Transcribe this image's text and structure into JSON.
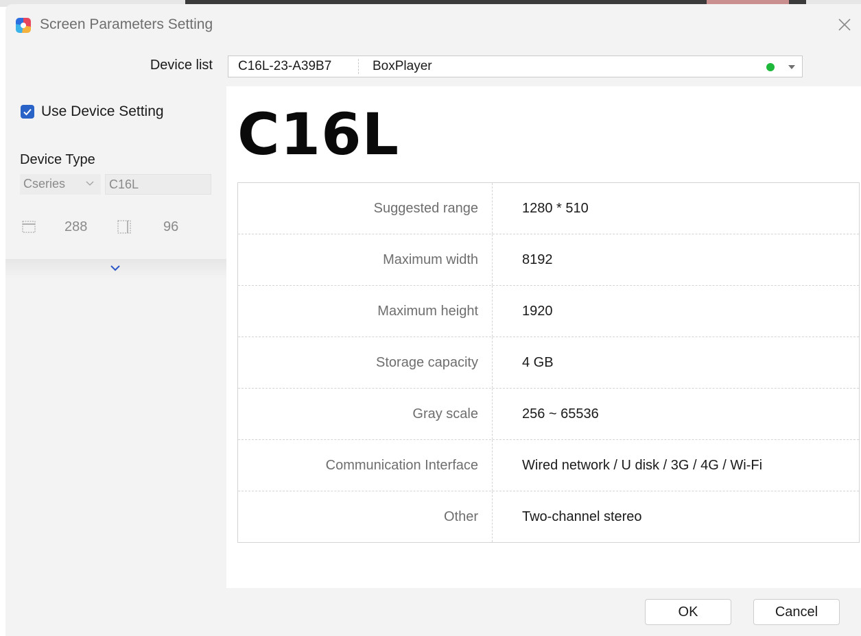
{
  "window": {
    "title": "Screen Parameters Setting"
  },
  "device_list": {
    "label": "Device list",
    "selected_id": "C16L-23-A39B7",
    "selected_name": "BoxPlayer",
    "status_color": "#1db83a"
  },
  "left_panel": {
    "use_device_setting": {
      "label": "Use Device Setting",
      "checked": true
    },
    "device_type_label": "Device Type",
    "series_value": "Cseries",
    "model_value": "C16L",
    "width_value": "288",
    "height_value": "96"
  },
  "main": {
    "model_title": "C16L",
    "specs": [
      {
        "key": "Suggested range",
        "value": "1280 * 510"
      },
      {
        "key": "Maximum width",
        "value": "8192"
      },
      {
        "key": "Maximum height",
        "value": "1920"
      },
      {
        "key": "Storage capacity",
        "value": "4 GB"
      },
      {
        "key": "Gray scale",
        "value": "256 ~ 65536"
      },
      {
        "key": "Communication Interface",
        "value": "Wired network / U disk / 3G / 4G / Wi-Fi"
      },
      {
        "key": "Other",
        "value": "Two-channel stereo"
      }
    ]
  },
  "buttons": {
    "ok": "OK",
    "cancel": "Cancel"
  },
  "colors": {
    "accent": "#2a63c7",
    "dialog_bg": "#f3f3f3"
  }
}
